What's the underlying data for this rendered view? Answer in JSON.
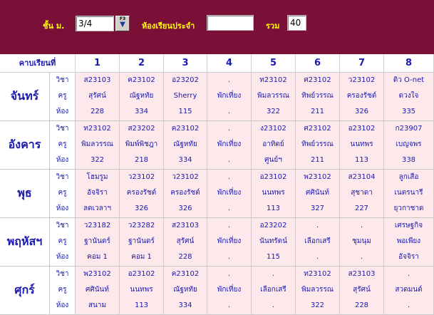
{
  "header": {
    "class_label": "ชั้น ม.",
    "class_value": "3/4",
    "f3_label": "F3",
    "homeroom_label": "ห้องเรียนประจำ",
    "homeroom_value": "",
    "total_label": "รวม",
    "total_value": "40"
  },
  "grid": {
    "corner_label": "คาบเรียนที่",
    "periods": [
      "1",
      "2",
      "3",
      "4",
      "5",
      "6",
      "7",
      "8"
    ],
    "row_labels": [
      "วิชา",
      "ครู",
      "ห้อง"
    ],
    "days": [
      {
        "name": "จันทร์",
        "cells": [
          [
            "ส23103",
            "สุรัศน์",
            "228"
          ],
          [
            "ค23102",
            "ณัฐหทัย",
            "334"
          ],
          [
            "อ23202",
            "Sherry",
            "115"
          ],
          [
            ".",
            "พักเที่ยง",
            "."
          ],
          [
            "ท23102",
            "พิมลวรรณ",
            "322"
          ],
          [
            "ศ23102",
            "ทิพย์วรรณ",
            "211"
          ],
          [
            "ว23102",
            "ครองรัชต์",
            "326"
          ],
          [
            "ติว O-net",
            "ดวงใจ",
            "335"
          ]
        ]
      },
      {
        "name": "อังคาร",
        "cells": [
          [
            "ท23102",
            "พิมลวรรณ",
            "322"
          ],
          [
            "ส23202",
            "พิมพ์พิชฎา",
            "218"
          ],
          [
            "ค23102",
            "ณัฐหทัย",
            "334"
          ],
          [
            ".",
            "พักเที่ยง",
            "."
          ],
          [
            "ง23102",
            "อาทิตย์",
            "ศูนย์ฯ"
          ],
          [
            "ศ23102",
            "ทิพย์วรรณ",
            "211"
          ],
          [
            "อ23102",
            "นนทพร",
            "113"
          ],
          [
            "ก23907",
            "เบญจพร",
            "338"
          ]
        ]
      },
      {
        "name": "พุธ",
        "cells": [
          [
            "โฮมรูม",
            "อัจจิรา",
            "ลดเวลาฯ"
          ],
          [
            "ว23102",
            "ครองรัชต์",
            "326"
          ],
          [
            "ว23102",
            "ครองรัชต์",
            "326"
          ],
          [
            ".",
            "พักเที่ยง",
            "."
          ],
          [
            "อ23102",
            "นนทพร",
            "113"
          ],
          [
            "พ23102",
            "ศศินันท์",
            "327"
          ],
          [
            "ส23104",
            "สุชาดา",
            "227"
          ],
          [
            "ลูกเสือ",
            "เนตรนารี",
            "ยุวกาชาด"
          ]
        ]
      },
      {
        "name": "พฤหัสฯ",
        "cells": [
          [
            "ว23182",
            "ฐานันดร์",
            "คอม 1"
          ],
          [
            "ว23282",
            "ฐานันดร์",
            "คอม 1"
          ],
          [
            "ส23103",
            "สุรัศน์",
            "228"
          ],
          [
            ".",
            "พักเที่ยง",
            "."
          ],
          [
            "อ23202",
            "นันทรัตน์",
            "115"
          ],
          [
            ".",
            "เลือกเสรี",
            "."
          ],
          [
            ".",
            "ชุมนุม",
            "."
          ],
          [
            "เศรษฐกิจ",
            "พอเพียง",
            "อัจจิรา"
          ]
        ]
      },
      {
        "name": "ศุกร์",
        "cells": [
          [
            "พ23102",
            "ศศินันท์",
            "สนาม"
          ],
          [
            "อ23102",
            "นนทพร",
            "113"
          ],
          [
            "ค23102",
            "ณัฐหทัย",
            "334"
          ],
          [
            ".",
            "พักเที่ยง",
            "."
          ],
          [
            ".",
            "เลือกเสรี",
            "."
          ],
          [
            "ท23102",
            "พิมลวรรณ",
            "322"
          ],
          [
            "ส23103",
            "สุรัศน์",
            "228"
          ],
          [
            ".",
            "สวดมนต์",
            "."
          ]
        ]
      }
    ]
  }
}
